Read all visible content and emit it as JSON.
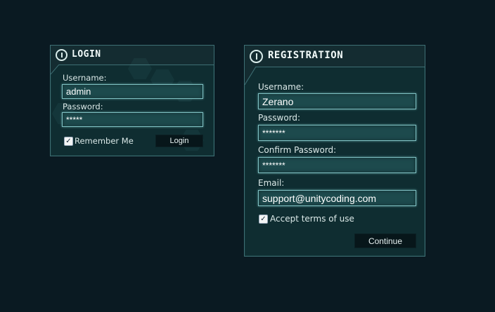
{
  "login": {
    "title": "LOGIN",
    "username_label": "Username:",
    "username_value": "admin",
    "password_label": "Password:",
    "password_value": "*****",
    "remember_label": "Remember Me",
    "remember_checked": true,
    "login_button": "Login"
  },
  "registration": {
    "title": "REGISTRATION",
    "username_label": "Username:",
    "username_value": "Zerano",
    "password_label": "Password:",
    "password_value": "*******",
    "confirm_label": "Confirm Password:",
    "confirm_value": "*******",
    "email_label": "Email:",
    "email_value": "support@unitycoding.com",
    "terms_label": "Accept terms of use",
    "terms_checked": true,
    "continue_button": "Continue"
  },
  "icons": {
    "header_icon": "power-icon",
    "checkmark": "✓"
  },
  "colors": {
    "background": "#0a1a22",
    "panel": "#0f2d31",
    "border": "#3e6f74",
    "field": "#1d4a4d",
    "button": "#07161a"
  }
}
